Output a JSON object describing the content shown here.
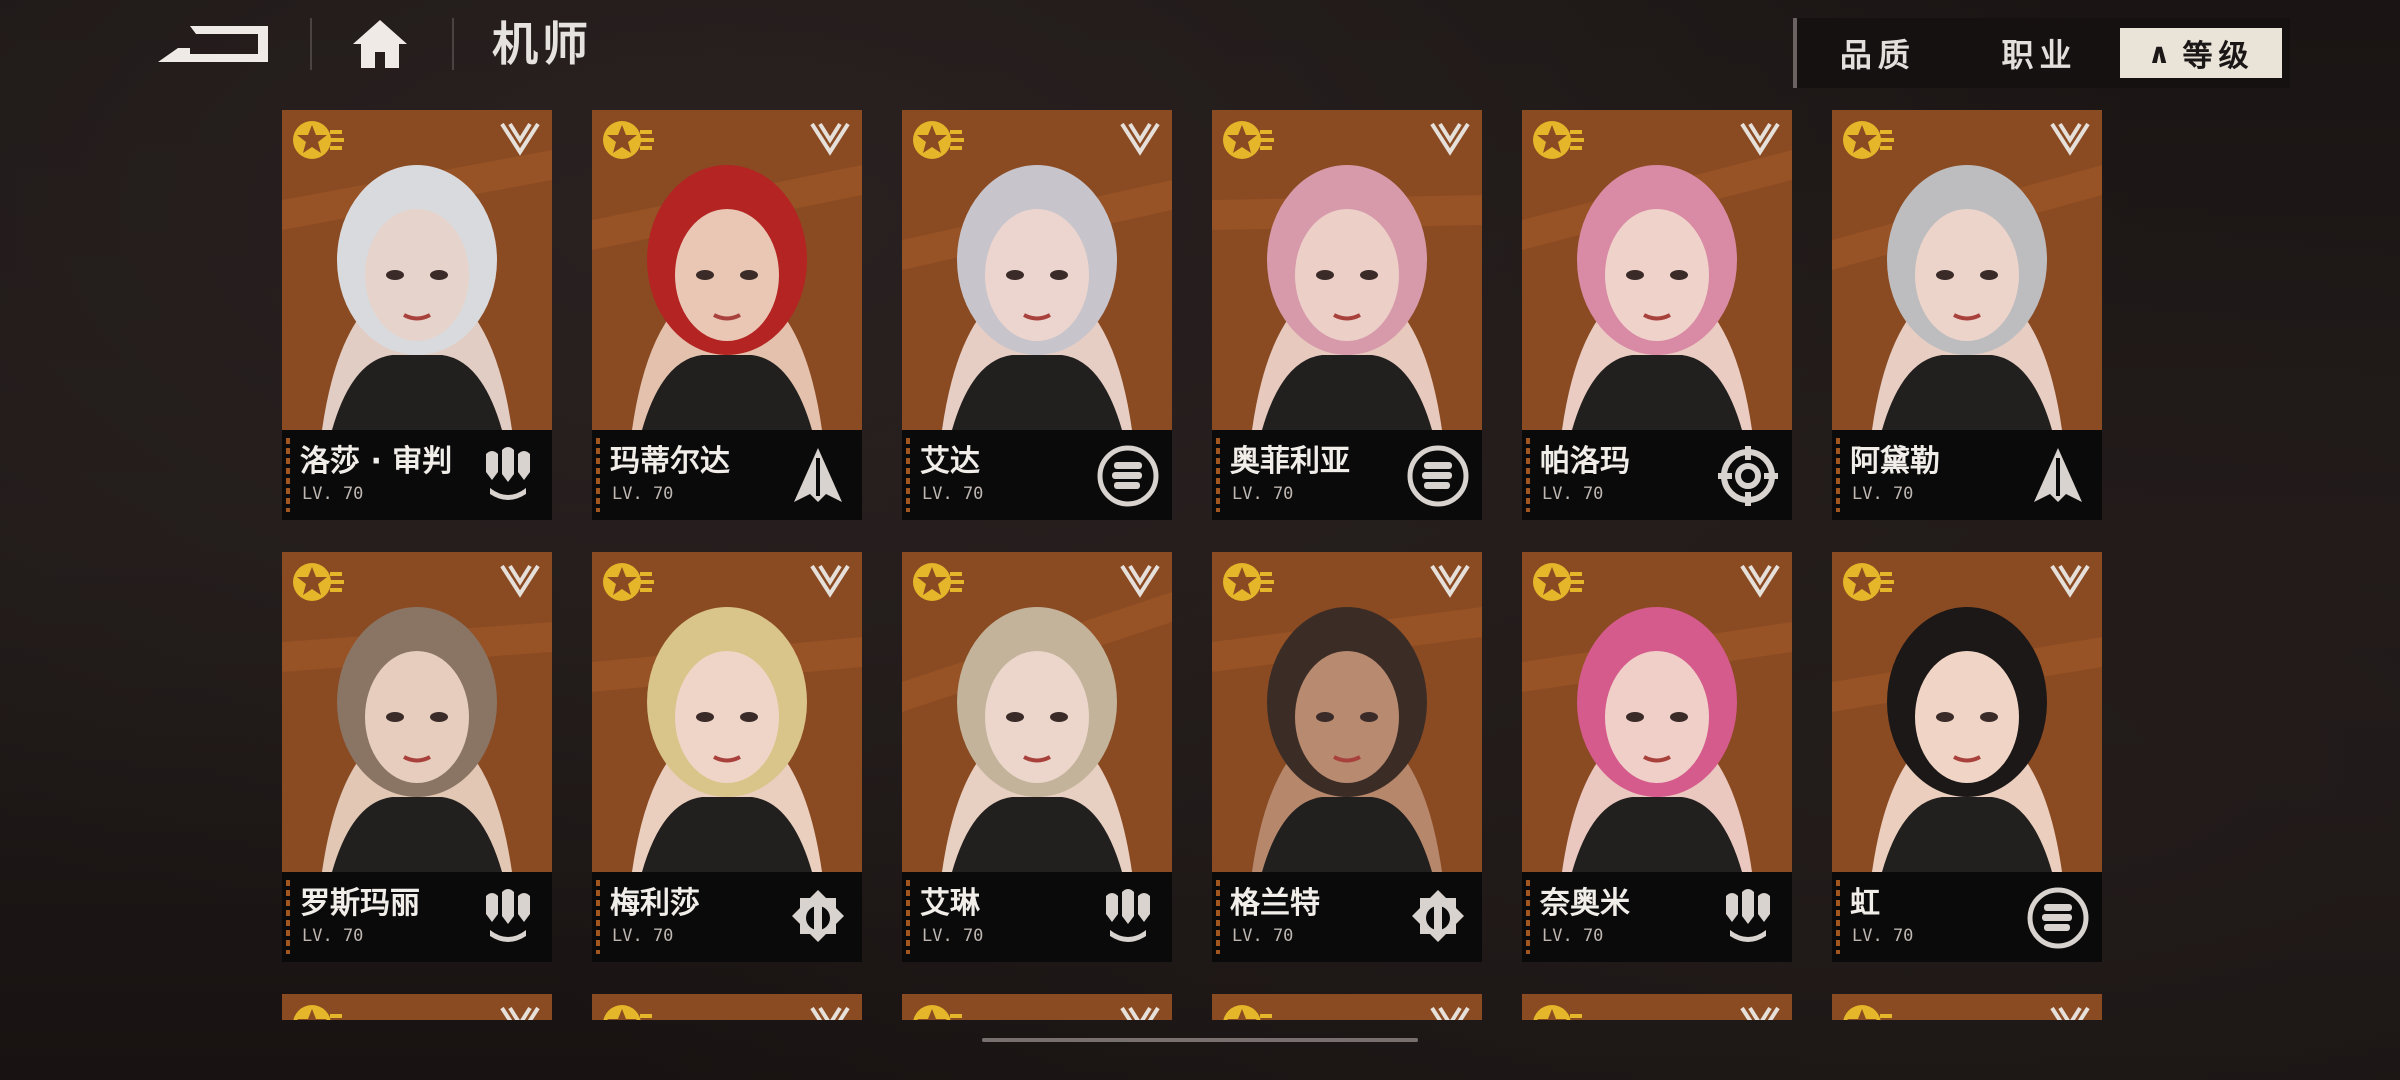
{
  "header": {
    "title": "机师",
    "icons": {
      "back": "back-arrow-icon",
      "home": "home-icon"
    }
  },
  "sort_tabs": {
    "quality": "品质",
    "profession": "职业",
    "level_arrow": "∧",
    "level": "等级",
    "active": "level"
  },
  "colors": {
    "card_orange": "#8a4a22",
    "active_tab": "#e9e3d8",
    "star_gold": "#e5b52a"
  },
  "characters": [
    {
      "name": "洛莎 · 审判",
      "level": "LV. 70",
      "class_icon": "missile-icon",
      "hair": "#d9dadd",
      "skin": "#e6d4cc",
      "bg": "#8a4a22"
    },
    {
      "name": "玛蒂尔达",
      "level": "LV. 70",
      "class_icon": "spear-icon",
      "hair": "#b32422",
      "skin": "#e9c7b4",
      "bg": "#8a4a22"
    },
    {
      "name": "艾达",
      "level": "LV. 70",
      "class_icon": "fist-icon",
      "hair": "#c7c4cc",
      "skin": "#ecd5ce",
      "bg": "#8a4a22"
    },
    {
      "name": "奥菲利亚",
      "level": "LV. 70",
      "class_icon": "fist-icon",
      "hair": "#d79aab",
      "skin": "#ecd0c7",
      "bg": "#8a4a22"
    },
    {
      "name": "帕洛玛",
      "level": "LV. 70",
      "class_icon": "target-icon",
      "hair": "#d98aa4",
      "skin": "#efd3cb",
      "bg": "#8a4a22"
    },
    {
      "name": "阿黛勒",
      "level": "LV. 70",
      "class_icon": "spear-icon",
      "hair": "#bdbdbf",
      "skin": "#ecd4cb",
      "bg": "#8a4a22"
    },
    {
      "name": "罗斯玛丽",
      "level": "LV. 70",
      "class_icon": "missile-icon",
      "hair": "#8a7565",
      "skin": "#e6cdbd",
      "bg": "#8a4a22"
    },
    {
      "name": "梅利莎",
      "level": "LV. 70",
      "class_icon": "wrench-icon",
      "hair": "#d9c48a",
      "skin": "#efd5c7",
      "bg": "#8a4a22"
    },
    {
      "name": "艾琳",
      "level": "LV. 70",
      "class_icon": "missile-icon",
      "hair": "#c2b39a",
      "skin": "#ecd6cb",
      "bg": "#8a4a22"
    },
    {
      "name": "格兰特",
      "level": "LV. 70",
      "class_icon": "wrench-icon",
      "hair": "#3b2d26",
      "skin": "#b88a70",
      "bg": "#8a4a22"
    },
    {
      "name": "奈奥米",
      "level": "LV. 70",
      "class_icon": "missile-icon",
      "hair": "#d45b8c",
      "skin": "#efcfc8",
      "bg": "#8a4a22"
    },
    {
      "name": "虹",
      "level": "LV. 70",
      "class_icon": "fist-icon",
      "hair": "#1c1818",
      "skin": "#f0d5c6",
      "bg": "#8a4a22"
    }
  ],
  "partial_row_count": 6
}
